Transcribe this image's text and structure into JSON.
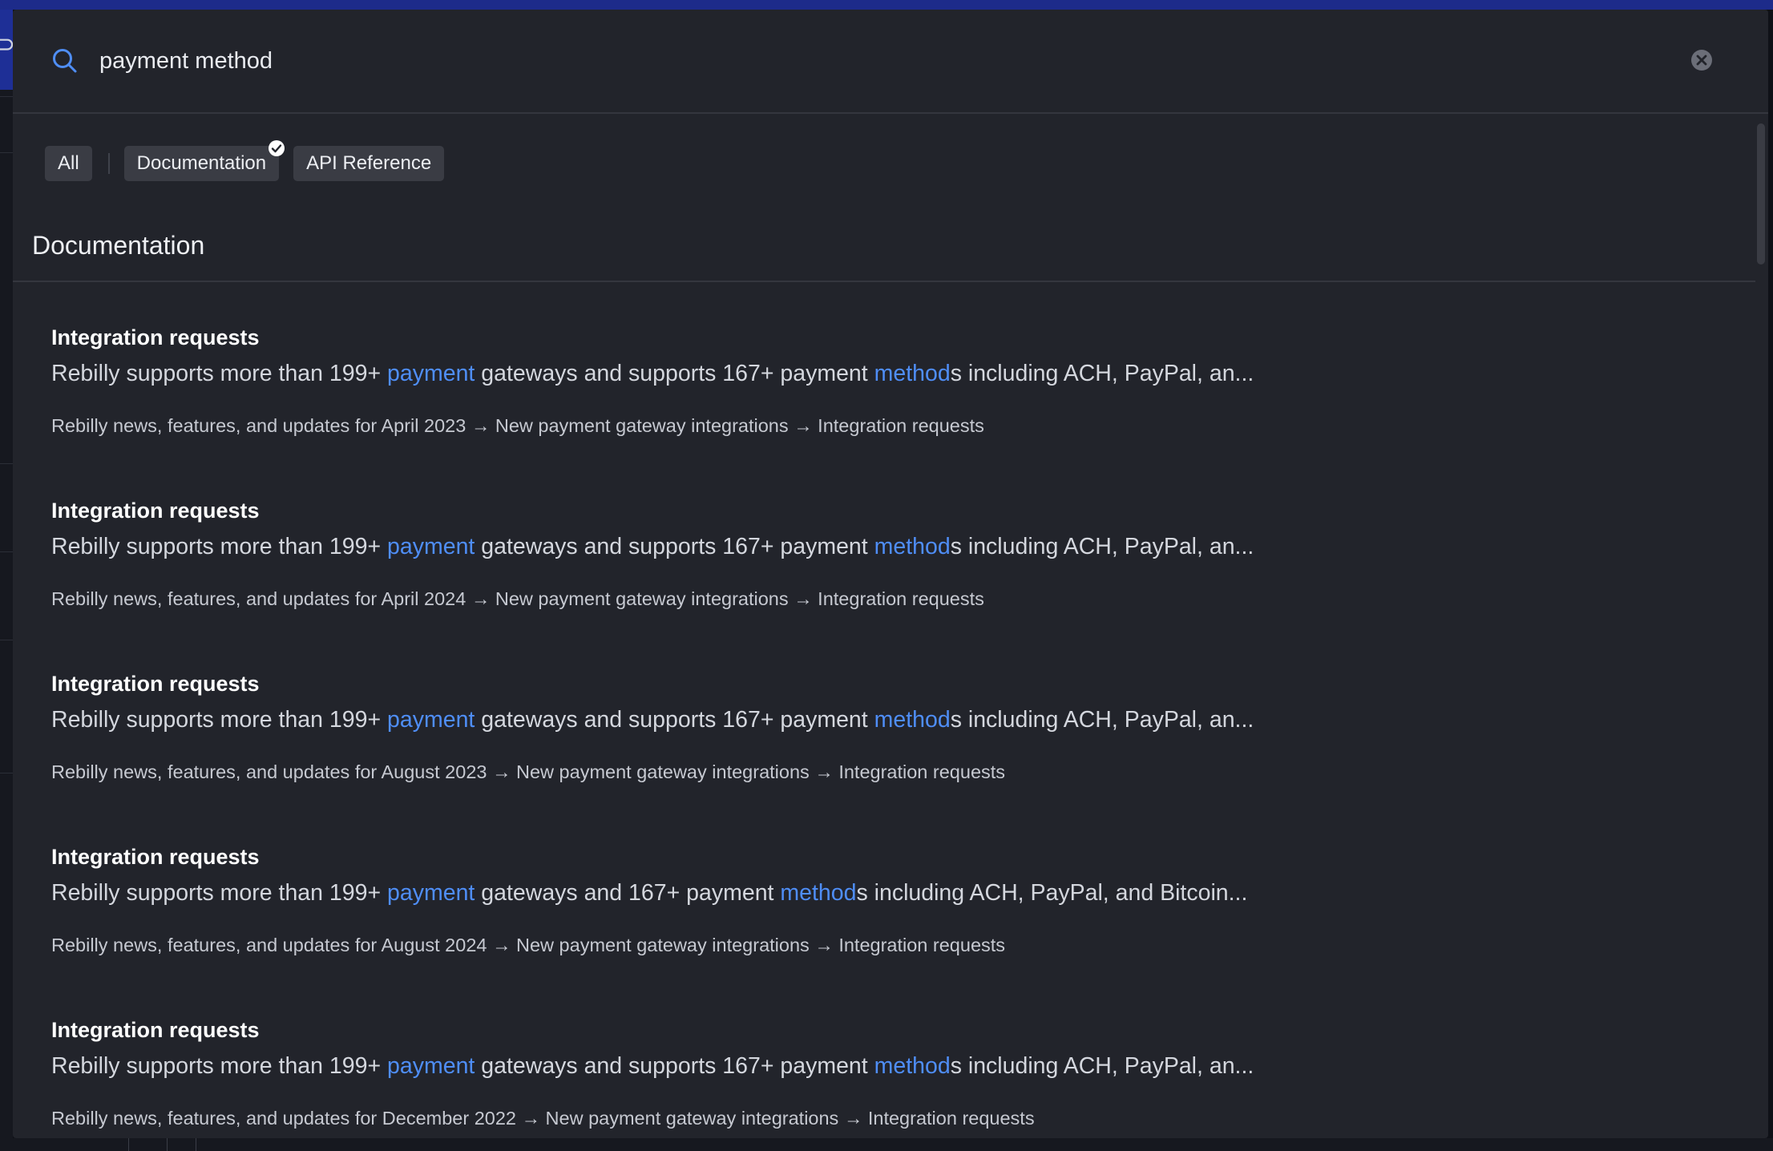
{
  "search": {
    "query": "payment method"
  },
  "filters": [
    {
      "label": "All",
      "selected": false
    },
    {
      "label": "Documentation",
      "selected": true
    },
    {
      "label": "API Reference",
      "selected": false
    }
  ],
  "section": {
    "title": "Documentation"
  },
  "results": [
    {
      "title": "Integration requests",
      "snippet": {
        "pre": "Rebilly supports more than 199+ ",
        "hl1": "payment",
        "mid": " gateways and supports 167+ payment ",
        "hl2": "method",
        "post": "s including ACH, PayPal, an..."
      },
      "path": "Rebilly news, features, and updates for April 2023 → New payment gateway integrations → Integration requests"
    },
    {
      "title": "Integration requests",
      "snippet": {
        "pre": "Rebilly supports more than 199+ ",
        "hl1": "payment",
        "mid": " gateways and supports 167+ payment ",
        "hl2": "method",
        "post": "s including ACH, PayPal, an..."
      },
      "path": "Rebilly news, features, and updates for April 2024 → New payment gateway integrations → Integration requests"
    },
    {
      "title": "Integration requests",
      "snippet": {
        "pre": "Rebilly supports more than 199+ ",
        "hl1": "payment",
        "mid": " gateways and supports 167+ payment ",
        "hl2": "method",
        "post": "s including ACH, PayPal, an..."
      },
      "path": "Rebilly news, features, and updates for August 2023 → New payment gateway integrations → Integration requests"
    },
    {
      "title": "Integration requests",
      "snippet": {
        "pre": "Rebilly supports more than 199+ ",
        "hl1": "payment",
        "mid": " gateways and 167+ payment ",
        "hl2": "method",
        "post": "s including ACH, PayPal, and Bitcoin..."
      },
      "path": "Rebilly news, features, and updates for August 2024 → New payment gateway integrations → Integration requests"
    },
    {
      "title": "Integration requests",
      "snippet": {
        "pre": "Rebilly supports more than 199+ ",
        "hl1": "payment",
        "mid": " gateways and supports 167+ payment ",
        "hl2": "method",
        "post": "s including ACH, PayPal, an..."
      },
      "path": "Rebilly news, features, and updates for December 2022 → New payment gateway integrations → Integration requests"
    }
  ],
  "colors": {
    "highlight": "#4f8ef7",
    "modal_bg": "#22242b",
    "chip_bg": "#3a3c44",
    "top_accent": "#1d2b8a"
  },
  "icons": {
    "search": "search-icon",
    "clear": "clear-icon",
    "selected": "check-circle-icon"
  }
}
